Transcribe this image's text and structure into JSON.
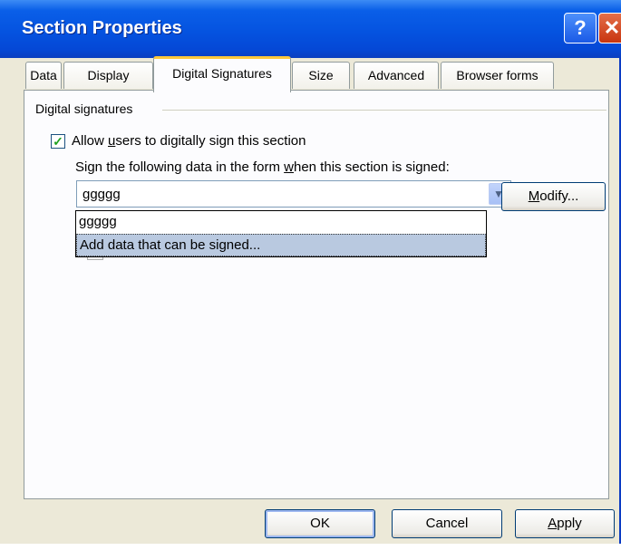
{
  "window": {
    "title": "Section Properties",
    "help_glyph": "?",
    "close_glyph": "✕"
  },
  "tabs": [
    {
      "label": "Data"
    },
    {
      "label": "Display"
    },
    {
      "label": "Digital Signatures"
    },
    {
      "label": "Size"
    },
    {
      "label": "Advanced"
    },
    {
      "label": "Browser forms"
    }
  ],
  "digital_signatures": {
    "group_label": "Digital signatures",
    "allow_checkbox": {
      "checked": true,
      "check_glyph": "✓",
      "pre": "Allow ",
      "underline": "u",
      "post": "sers to digitally sign this section"
    },
    "sign_data_label": {
      "pre": "Sign the following data in the form ",
      "underline": "w",
      "post": "hen this section is signed:"
    },
    "combo": {
      "value": "ggggg",
      "arrow_glyph": "▼"
    },
    "dropdown_items": [
      "ggggg",
      "Add data that can be signed..."
    ],
    "modify_button": {
      "underline": "M",
      "rest": "odify..."
    }
  },
  "footer": {
    "ok": "OK",
    "cancel": "Cancel",
    "apply": {
      "underline": "A",
      "rest": "pply"
    }
  },
  "colors": {
    "titlebar": "#0553e0",
    "dialog_bg": "#ece9d8",
    "panel_bg": "#fcfcfe",
    "active_tab_accent": "#ffc83c",
    "selection": "#b9c9e0"
  }
}
